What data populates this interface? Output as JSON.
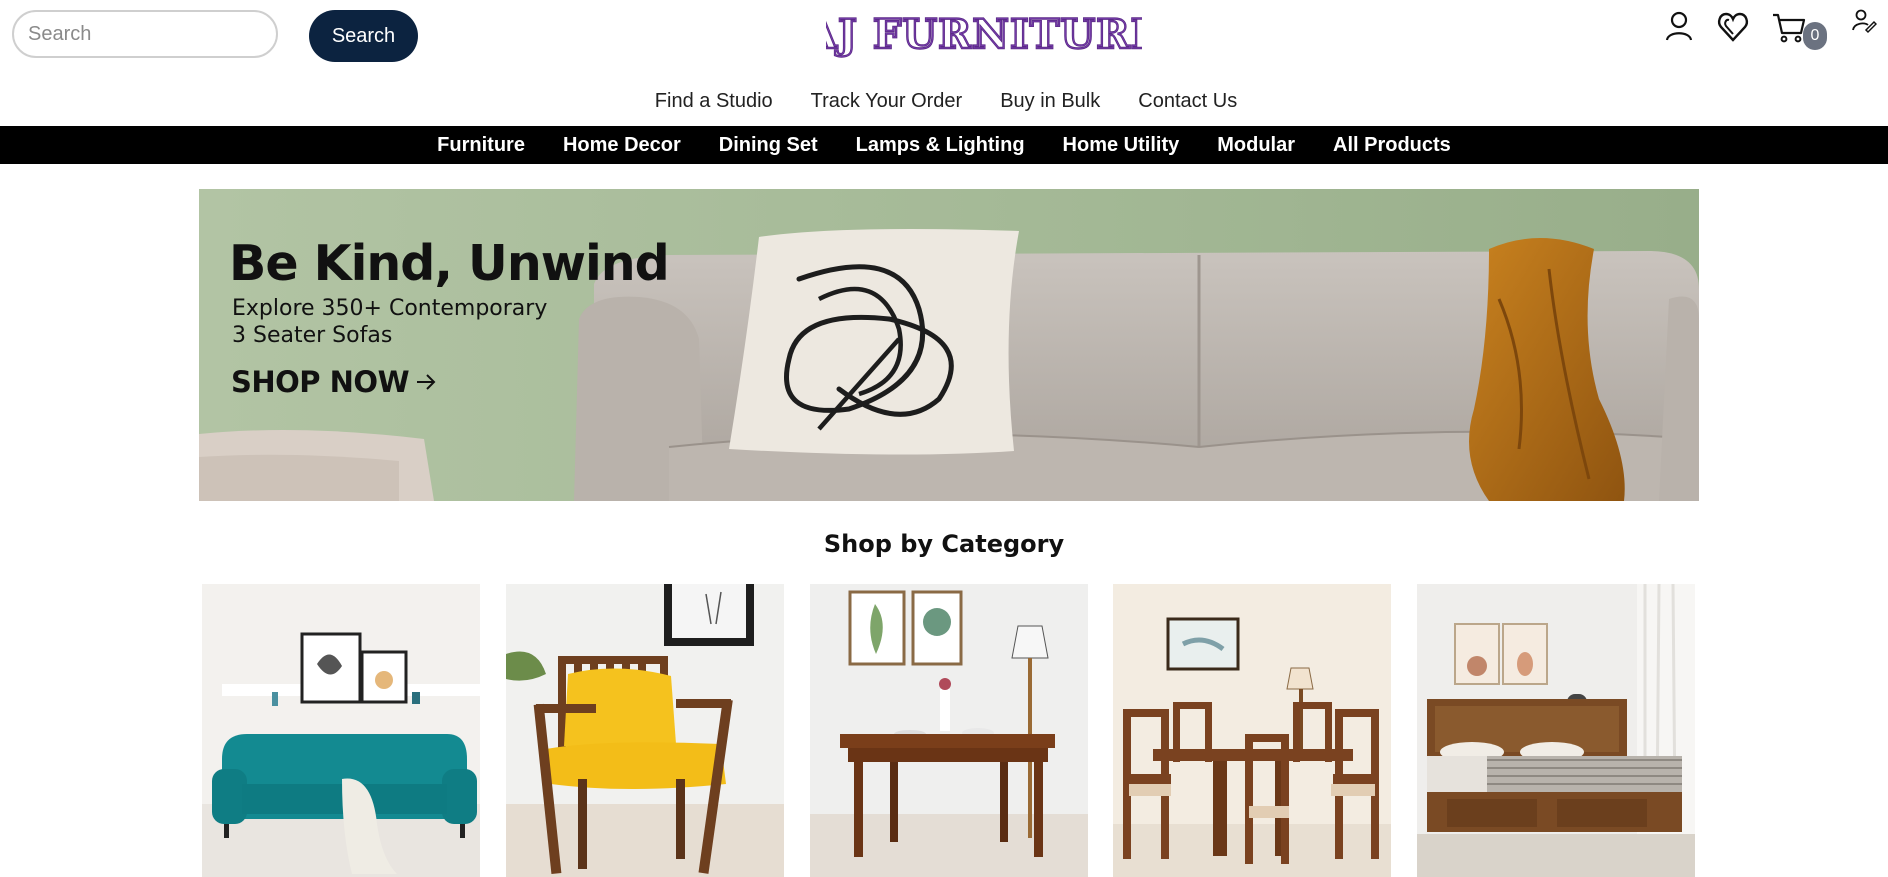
{
  "header": {
    "search_placeholder": "Search",
    "search_button": "Search",
    "logo_text": "AJ Furniture",
    "cart_count": "0",
    "icons": [
      "user-icon",
      "wishlist-heart-icon",
      "cart-icon",
      "user-edit-icon"
    ]
  },
  "util_links": [
    "Find a Studio",
    "Track Your Order",
    "Buy in Bulk",
    "Contact Us"
  ],
  "categories_nav": [
    "Furniture",
    "Home Decor",
    "Dining Set",
    "Lamps & Lighting",
    "Home Utility",
    "Modular",
    "All Products"
  ],
  "banner": {
    "headline": "Be Kind, Unwind",
    "sub_line1": "Explore 350+ Contemporary",
    "sub_line2": "3 Seater Sofas",
    "cta": "SHOP NOW"
  },
  "section": {
    "title": "Shop by Category"
  },
  "tiles": [
    "sofa",
    "accent-chair",
    "study-table",
    "dining-set",
    "bed"
  ],
  "colors": {
    "brand_purple": "#5b2a86",
    "navy": "#0c2340",
    "banner_green": "#a9bd9a",
    "nav_bar": "#000000"
  }
}
